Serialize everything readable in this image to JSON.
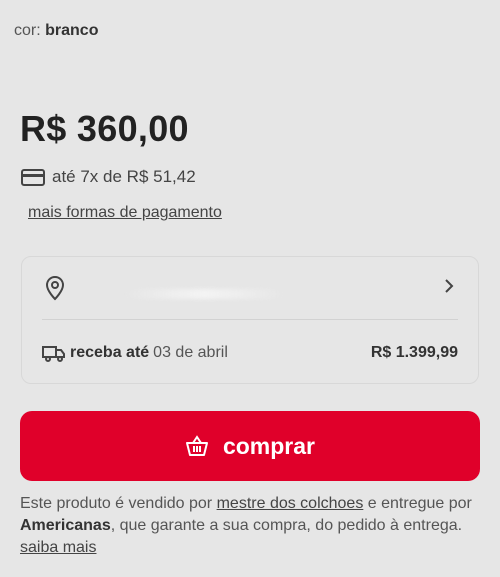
{
  "product": {
    "color_label": "cor:",
    "color_value": "branco",
    "price": "R$ 360,00",
    "installments": "até 7x de R$ 51,42",
    "more_payment": "mais formas de pagamento"
  },
  "shipping": {
    "delivery_label": "receba até",
    "delivery_date": "03 de abril",
    "shipping_price": "R$ 1.399,99"
  },
  "buy_button": {
    "label": "comprar",
    "color": "#e0002a"
  },
  "seller": {
    "text1": "Este produto é vendido por",
    "seller_name": "mestre dos colchoes",
    "text2": "e entregue por",
    "deliverer": "Americanas",
    "text3": ", que garante a sua compra, do pedido à entrega.",
    "learn_more": "saiba mais"
  },
  "icons": [
    "credit-card-icon",
    "location-pin-icon",
    "chevron-right-icon",
    "truck-icon",
    "basket-icon"
  ]
}
